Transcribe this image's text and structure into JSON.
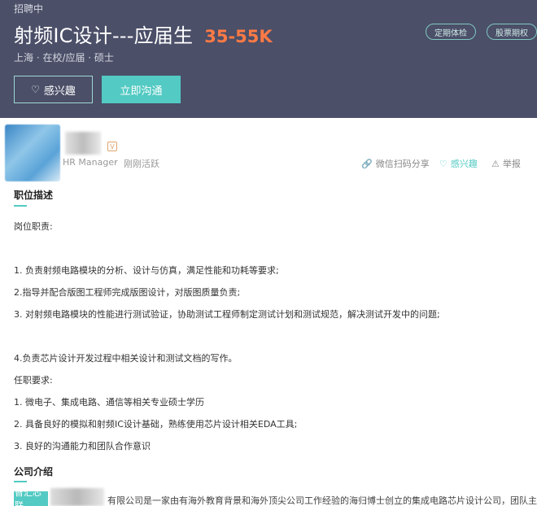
{
  "job": {
    "status": "招聘中",
    "title": "射频IC设计---应届生",
    "salary": "35-55K",
    "meta": "上海 · 在校/应届 · 硕士",
    "tags": [
      "定期体检",
      "股票期权"
    ],
    "interest_label": "感兴趣",
    "contact_label": "立即沟通"
  },
  "recruiter": {
    "role": "HR Manager",
    "separator": "·",
    "activity": "刚刚活跃",
    "badge": "V"
  },
  "actions": {
    "share": "微信扫码分享",
    "favorite": "感兴趣",
    "report": "举报"
  },
  "description": {
    "title": "职位描述",
    "lines": [
      "岗位职责:",
      "1. 负责射频电路模块的分析、设计与仿真，满足性能和功耗等要求;",
      "2.指导并配合版图工程师完成版图设计，对版图质量负责;",
      "3. 对射频电路模块的性能进行测试验证，协助测试工程师制定测试计划和测试规范，解决测试开发中的问题;",
      "4.负责芯片设计开发过程中相关设计和测试文档的写作。",
      "任职要求:",
      "1. 微电子、集成电路、通信等相关专业硕士学历",
      "2. 具备良好的模拟和射频IC设计基础，熟练使用芯片设计相关EDA工具;",
      "3. 良好的沟通能力和团队合作意识"
    ]
  },
  "company": {
    "title": "公司介绍",
    "logo_text": "智汇芯联",
    "intro": "有限公司是一家由有海外教育背景和海外顶尖公司工作经验的海归博士创立的集成电路芯片设计公司，团队主"
  },
  "colors": {
    "header_bg": "#4b4f68",
    "accent": "#53cac3",
    "salary": "#ff7a45"
  }
}
